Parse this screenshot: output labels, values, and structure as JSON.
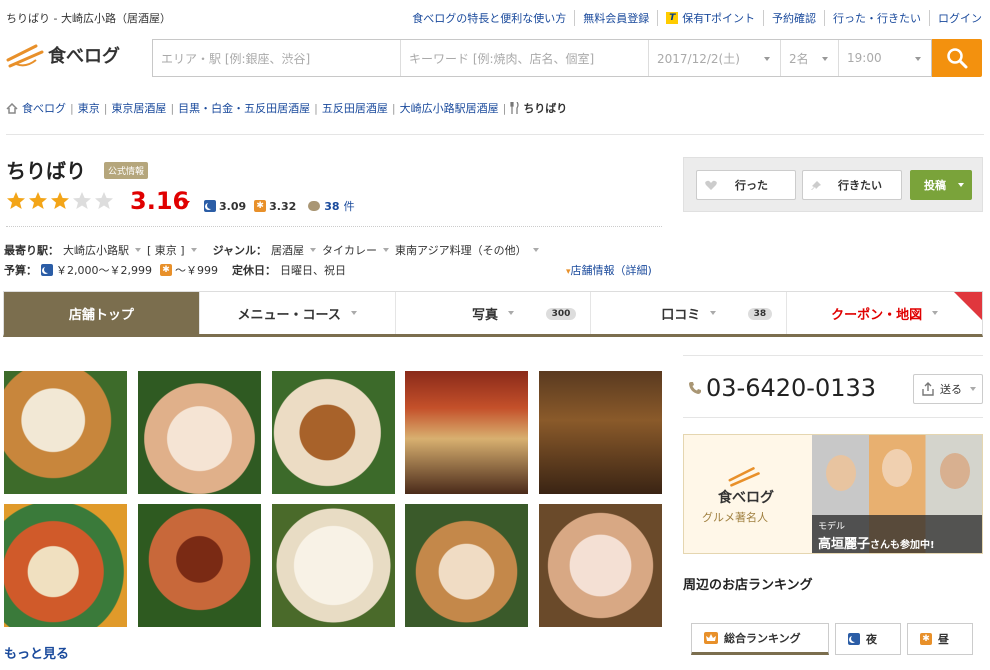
{
  "topbar": {
    "title": "ちりばり - 大崎広小路（居酒屋）",
    "links": [
      "食べログの特長と便利な使い方",
      "無料会員登録",
      "保有Tポイント",
      "予約確認",
      "行った・行きたい",
      "ログイン"
    ]
  },
  "header": {
    "logo_text": "食べログ",
    "area_placeholder": "エリア・駅 [例:銀座、渋谷]",
    "keyword_placeholder": "キーワード [例:焼肉、店名、個室]",
    "date": "2017/12/2(土)",
    "people": "2名",
    "time": "19:00"
  },
  "breadcrumb": [
    "食べログ",
    "東京",
    "東京居酒屋",
    "目黒・白金・五反田居酒屋",
    "五反田居酒屋",
    "大崎広小路駅居酒屋",
    "ちりばり"
  ],
  "restaurant": {
    "name": "ちりばり",
    "official_badge": "公式情報",
    "rating": "3.16",
    "rating_value": 3.16,
    "night_rating": "3.09",
    "day_rating": "3.32",
    "review_count": "38",
    "review_unit": "件",
    "station_label": "最寄り駅：",
    "station": "大崎広小路駅",
    "station_area": "[ 東京 ]",
    "genre_label": "ジャンル：",
    "genres": [
      "居酒屋",
      "タイカレー",
      "東南アジア料理（その他）"
    ],
    "budget_label": "予算：",
    "budget_night": "￥2,000～￥2,999",
    "budget_day": "～￥999",
    "holiday_label": "定休日：",
    "holiday": "日曜日、祝日",
    "shop_info_link": "店舗情報（詳細)"
  },
  "actions": {
    "went": "行った",
    "want": "行きたい",
    "post": "投稿"
  },
  "tabs": [
    {
      "label": "店舗トップ",
      "badge": ""
    },
    {
      "label": "メニュー・コース",
      "badge": ""
    },
    {
      "label": "写真",
      "badge": "300"
    },
    {
      "label": "口コミ",
      "badge": "38"
    },
    {
      "label": "クーポン・地図",
      "badge": ""
    }
  ],
  "more_link": "もっと見る",
  "sidebar": {
    "phone": "03-6420-0133",
    "send": "送る",
    "banner_logo": "食べログ",
    "banner_sub": "グルメ著名人",
    "banner_model": "モデル",
    "banner_name": "高垣麗子",
    "banner_suffix": "さんも参加中!",
    "ranking_title": "周辺のお店ランキング",
    "rank_tabs": [
      "総合ランキング",
      "夜",
      "昼"
    ]
  },
  "colors": {
    "accent_orange": "#f3910e",
    "score_red": "#e00000",
    "link_blue": "#1a4a9c",
    "tab_brown": "#7b6e4e",
    "post_green": "#7aa33a"
  }
}
